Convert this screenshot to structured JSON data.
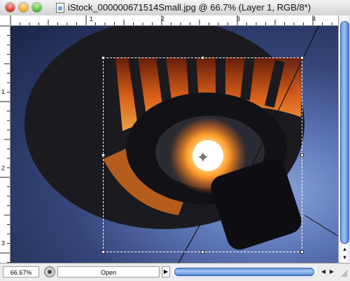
{
  "window": {
    "title": "iStock_000000671514Small.jpg @ 66.7% (Layer 1, RGB/8*)"
  },
  "rulers": {
    "top": [
      "1",
      "2",
      "3",
      "4"
    ],
    "left": [
      "1",
      "2",
      "3"
    ]
  },
  "status": {
    "zoom_value": "66.67%",
    "info_text": "Open"
  },
  "colors": {
    "selection_marquee": "#ffffff",
    "scroll_thumb": "#5d8fd6"
  },
  "icons": {
    "close": "close-icon",
    "minimize": "minimize-icon",
    "zoom": "zoom-icon",
    "document": "document-icon",
    "status_menu": "status-menu-icon",
    "play": "play-icon",
    "scroll_up": "arrow-up-icon",
    "scroll_down": "arrow-down-icon",
    "scroll_left": "arrow-left-icon",
    "scroll_right": "arrow-right-icon"
  }
}
